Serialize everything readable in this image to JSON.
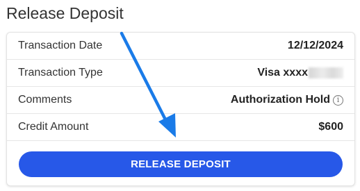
{
  "page": {
    "title": "Release Deposit"
  },
  "details": {
    "rows": [
      {
        "label": "Transaction Date",
        "value": "12/12/2024"
      },
      {
        "label": "Transaction Type",
        "value": "Visa xxxx"
      },
      {
        "label": "Comments",
        "value": "Authorization Hold"
      },
      {
        "label": "Credit Amount",
        "value": "$600"
      }
    ],
    "info_icon_glyph": "i"
  },
  "actions": {
    "release_label": "RELEASE DEPOSIT"
  },
  "colors": {
    "accent": "#2758e8",
    "arrow": "#1a7be8"
  }
}
